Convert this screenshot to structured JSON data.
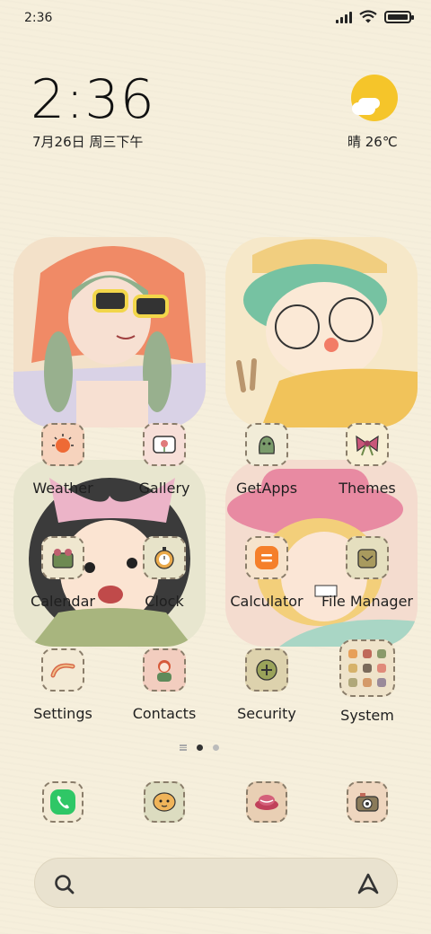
{
  "status_bar": {
    "time": "2:36"
  },
  "clock_widget": {
    "time": "2:36",
    "date": "7月26日 周三下午"
  },
  "weather_widget": {
    "condition_temp": "晴 26℃",
    "sun_color": "#f5c52a"
  },
  "apps": [
    {
      "id": "weather",
      "label": "Weather",
      "icon": "weather-icon"
    },
    {
      "id": "gallery",
      "label": "Gallery",
      "icon": "gallery-icon"
    },
    {
      "id": "getapps",
      "label": "GetApps",
      "icon": "getapps-icon"
    },
    {
      "id": "themes",
      "label": "Themes",
      "icon": "themes-icon"
    },
    {
      "id": "calendar",
      "label": "Calendar",
      "icon": "calendar-icon"
    },
    {
      "id": "clock",
      "label": "Clock",
      "icon": "clock-icon"
    },
    {
      "id": "calculator",
      "label": "Calculator",
      "icon": "calculator-icon"
    },
    {
      "id": "file_manager",
      "label": "File Manager",
      "icon": "folder-icon"
    },
    {
      "id": "settings",
      "label": "Settings",
      "icon": "settings-icon"
    },
    {
      "id": "contacts",
      "label": "Contacts",
      "icon": "contacts-icon"
    },
    {
      "id": "security",
      "label": "Security",
      "icon": "security-icon"
    },
    {
      "id": "system",
      "label": "System",
      "icon": "system-folder-icon"
    }
  ],
  "dock": [
    {
      "id": "phone",
      "icon": "phone-icon"
    },
    {
      "id": "messages",
      "icon": "messages-icon"
    },
    {
      "id": "browser",
      "icon": "browser-icon"
    },
    {
      "id": "camera",
      "icon": "camera-icon"
    }
  ],
  "pager": {
    "pages": 2,
    "active": 1
  },
  "search_bar": {
    "left_icon": "search-icon",
    "right_icon": "assistant-icon"
  },
  "colors": {
    "background": "#f6efdc",
    "accent_orange": "#f57f2a",
    "phone_green": "#2fc766"
  }
}
